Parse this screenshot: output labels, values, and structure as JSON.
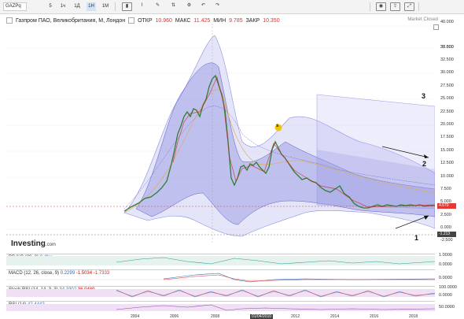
{
  "toolbar": {
    "symbol": "GAZPq",
    "intervals": [
      "5",
      "1ч",
      "1Д",
      "1Н",
      "1М"
    ],
    "active_interval": "1Н",
    "tools": [
      "chart-type-icon",
      "indicators-icon",
      "drawing-icon",
      "compare-icon",
      "settings-icon",
      "undo-icon",
      "redo-icon"
    ],
    "right_tools": [
      "camera-icon",
      "share-icon",
      "fullscreen-icon"
    ]
  },
  "header": {
    "title": "Газпром ПАО, Великобритания, М, Лондон",
    "open_label": "ОТКР",
    "open_value": "10.960",
    "high_label": "МАКС",
    "high_value": "11.425",
    "low_label": "МИН",
    "low_value": "9.785",
    "close_label": "ЗАКР",
    "close_value": "10.350",
    "market_status": "Market Closed"
  },
  "price_axis": {
    "labels": [
      "40.000",
      "37.500",
      "35.000",
      "32.500",
      "30.000",
      "27.500",
      "25.000",
      "22.500",
      "20.000",
      "17.500",
      "15.000",
      "12.500",
      "10.000",
      "7.500",
      "5.000",
      "2.500",
      "0.000",
      "-2.500"
    ],
    "current_price": "4.670",
    "low_marker": "-1.213",
    "current_color": "#e53935"
  },
  "logo": {
    "brand": "Investing",
    "suffix": ".com"
  },
  "panels": [
    {
      "name": "BB %B",
      "label": "BB %B (20, 2)",
      "value": "0.4fss",
      "axis": [
        "1.0000",
        "0.0000"
      ]
    },
    {
      "name": "MACD",
      "label": "MACD (12, 26, close, 9)",
      "values": [
        "0.2299",
        "-1.5034",
        "-1.7333"
      ],
      "axis": [
        "0.0000"
      ]
    },
    {
      "name": "Stoch RSI",
      "label": "Stoch RSI (14, 14, 3, 3)",
      "values": [
        "34.1902",
        "36.9489"
      ],
      "axis": [
        "100.0000",
        "0.0000"
      ]
    },
    {
      "name": "RSI",
      "label": "RSI (14)",
      "value": "42.4442",
      "axis": [
        "50.0000"
      ]
    }
  ],
  "xaxis": {
    "labels": [
      "2004",
      "2006",
      "2008",
      "2010",
      "2012",
      "2014",
      "2016",
      "2018"
    ],
    "highlight": "01/04/2010"
  },
  "annotations": {
    "one": "1",
    "two": "2",
    "three": "3",
    "marker": "s"
  },
  "colors": {
    "band": "#6b6bd6",
    "up": "#26a69a",
    "down": "#ef5350",
    "current": "#e53935"
  }
}
